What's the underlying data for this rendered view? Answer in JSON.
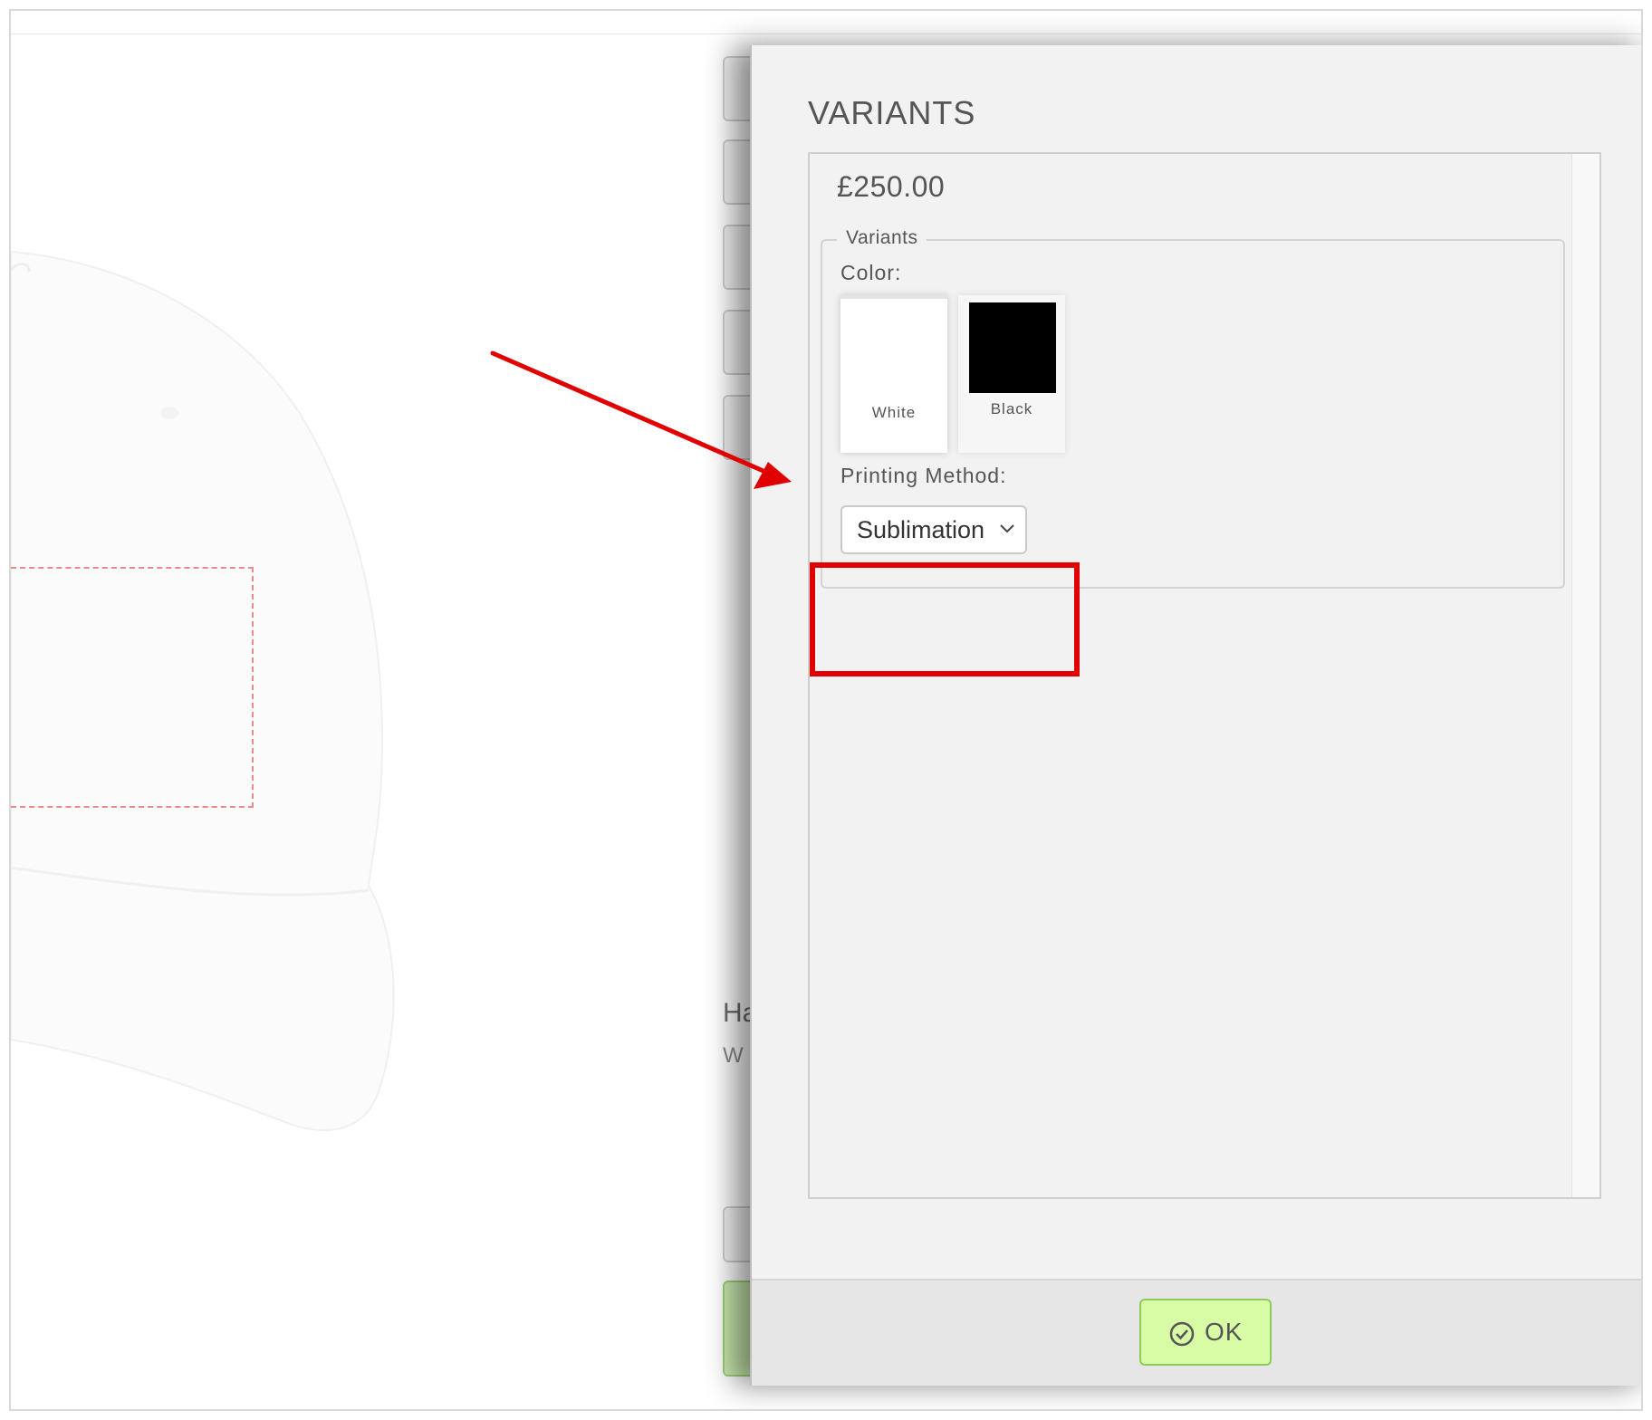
{
  "background": {
    "product_title_partial": "Ha",
    "product_subtitle_partial": "W"
  },
  "modal": {
    "title": "VARIANTS",
    "price": "£250.00",
    "fieldset_legend": "Variants",
    "color_label": "Color:",
    "colors": [
      {
        "name": "White",
        "hex": "#ffffff",
        "selected": true
      },
      {
        "name": "Black",
        "hex": "#000000",
        "selected": false
      }
    ],
    "printing_method_label": "Printing Method:",
    "printing_method_value": "Sublimation",
    "ok_label": "OK"
  },
  "annotation": {
    "highlight_color": "#e00000"
  },
  "icons": {
    "ok": "check-circle-icon",
    "select": "chevron-down-icon"
  }
}
